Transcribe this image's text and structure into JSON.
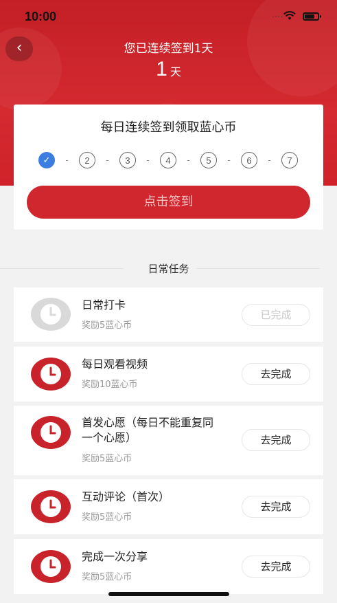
{
  "status_bar": {
    "time": "10:00",
    "signal": "...."
  },
  "header": {
    "title": "您已连续签到1天",
    "days_number": "1",
    "days_unit": "天",
    "back_icon": "‹"
  },
  "sign_card": {
    "title": "每日连续签到领取蓝心币",
    "steps": [
      {
        "label": "✓",
        "done": true
      },
      {
        "label": "2",
        "done": false
      },
      {
        "label": "3",
        "done": false
      },
      {
        "label": "4",
        "done": false
      },
      {
        "label": "5",
        "done": false
      },
      {
        "label": "6",
        "done": false
      },
      {
        "label": "7",
        "done": false
      }
    ],
    "button_label": "点击签到"
  },
  "section": {
    "title": "日常任务"
  },
  "tasks": [
    {
      "name": "日常打卡",
      "reward": "奖励5蓝心币",
      "button": "已完成",
      "completed": true,
      "icon": "clock-icon"
    },
    {
      "name": "每日观看视频",
      "reward": "奖励10蓝心币",
      "button": "去完成",
      "completed": false,
      "icon": "clock-icon"
    },
    {
      "name": "首发心愿（每日不能重复同一个心愿）",
      "name_line1": "首发心愿（每日不能重复同",
      "name_line2": "一个心愿）",
      "reward": "奖励5蓝心币",
      "button": "去完成",
      "completed": false,
      "icon": "clock-icon"
    },
    {
      "name": "互动评论（首次）",
      "reward": "奖励5蓝心币",
      "button": "去完成",
      "completed": false,
      "icon": "clock-icon"
    },
    {
      "name": "完成一次分享",
      "reward": "奖励5蓝心币",
      "button": "去完成",
      "completed": false,
      "icon": "clock-icon"
    }
  ],
  "colors": {
    "brand_red": "#d0262d",
    "check_blue": "#3b7de0",
    "done_gray": "#d6d6d6"
  }
}
